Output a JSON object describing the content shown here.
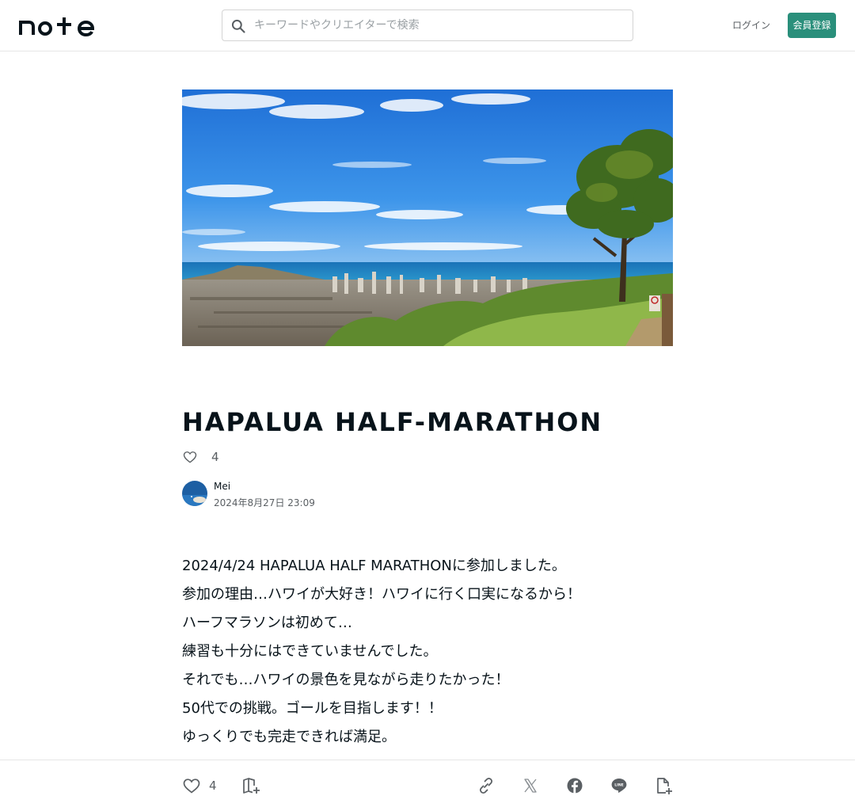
{
  "header": {
    "logo_text": "note",
    "search_placeholder": "キーワードやクリエイターで検索",
    "login_label": "ログイン",
    "signup_label": "会員登録",
    "accent_color": "#2a8f7b"
  },
  "article": {
    "title": "HAPALUA HALF-MARATHON",
    "like_count": "4",
    "author_name": "Mei",
    "date": "2024年8月27日 23:09",
    "hero_image": "landscape-photo-honolulu-view",
    "body_lines": [
      "2024/4/24 HAPALUA HALF MARATHONに参加しました。",
      "参加の理由…ハワイが大好き！ハワイに行く口実になるから！",
      "ハーフマラソンは初めて…",
      "練習も十分にはできていませんでした。",
      "それでも…ハワイの景色を見ながら走りたかった！",
      "50代での挑戦。ゴールを目指します！！",
      "ゆっくりでも完走できれば満足。",
      "＿＿＿＿＿＿＿＿＿＿＿＿＿＿＿＿＿＿＿＿＿"
    ]
  },
  "bottom_bar": {
    "like_count": "4",
    "icons": [
      "heart-icon",
      "magazine-add-icon",
      "link-icon",
      "x-icon",
      "facebook-icon",
      "line-icon",
      "note-add-icon"
    ]
  }
}
